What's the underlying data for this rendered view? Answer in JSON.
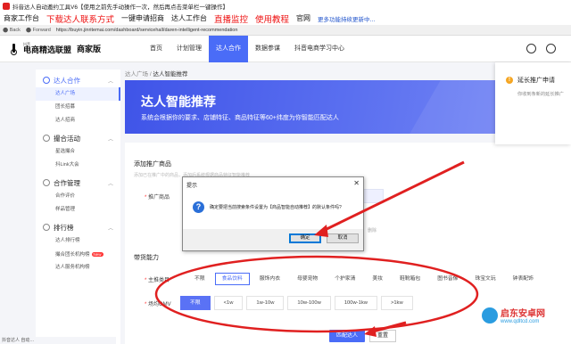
{
  "window": {
    "title": "抖音达人自动邀约工具V6【使用之前先手动操作一次，然后再点击菜单栏一键操作】"
  },
  "linkbar": {
    "items": [
      {
        "label": "商家工作台",
        "style": "black"
      },
      {
        "label": "下载达人联系方式",
        "style": "red"
      },
      {
        "label": "一键申请招商",
        "style": "black"
      },
      {
        "label": "达人工作台",
        "style": "black"
      },
      {
        "label": "直播监控",
        "style": "red"
      },
      {
        "label": "使用教程",
        "style": "red"
      },
      {
        "label": "官网",
        "style": "black"
      },
      {
        "label": "更多功能持续更新中...",
        "style": "blue"
      }
    ]
  },
  "addressbar": {
    "back": "Back",
    "forward": "Forward",
    "url": "https://buyin.jinritemai.com/dashboard/servicehall/daren-intelligent-recommendation"
  },
  "header": {
    "logo_top": "抖音",
    "logo_main": "电商精选联盟",
    "merchant": "商家版",
    "nav": [
      "首页",
      "计划管理",
      "达人合作",
      "数据参谋",
      "抖音电商学习中心"
    ],
    "active_nav": 2
  },
  "sidebar": {
    "groups": [
      {
        "label": "达人合作",
        "highlight": true,
        "items": [
          {
            "label": "达人广场",
            "active": true
          },
          {
            "label": "团长招募"
          },
          {
            "label": "达人招商"
          }
        ]
      },
      {
        "label": "撮合活动",
        "items": [
          {
            "label": "星选撮合"
          },
          {
            "label": "抖Link大会"
          }
        ]
      },
      {
        "label": "合作管理",
        "items": [
          {
            "label": "合作评价"
          },
          {
            "label": "样品管理"
          }
        ]
      },
      {
        "label": "排行榜",
        "items": [
          {
            "label": "达人排行榜"
          },
          {
            "label": "撮合团长机构榜",
            "badge": "New"
          },
          {
            "label": "达人服务机构榜"
          }
        ]
      }
    ]
  },
  "breadcrumb": {
    "parent": "达人广场",
    "sep": "/",
    "current": "达人智能推荐"
  },
  "banner": {
    "title": "达人智能推荐",
    "subtitle": "系统会根据你的要求、店铺特征、商品特征等60+纬度为你智能匹配达人"
  },
  "form": {
    "section1": "添加推广商品",
    "section1_hint": "添加已在推广中的商品，添加后系统根据商品特征智能推荐",
    "product_label": "推广商品",
    "delete_label": "删除",
    "section2": "带货能力",
    "category_label": "主推类目",
    "categories": [
      "不限",
      "食品饮料",
      "服饰内衣",
      "母婴宠物",
      "个护家清",
      "美妆",
      "鞋靴箱包",
      "图书音像",
      "珠宝文玩",
      "钟表配饰"
    ],
    "selected_category": 1,
    "gmv_label": "场均GMV",
    "gmv_options": [
      "不限",
      "<1w",
      "1w-10w",
      "10w-100w",
      "100w-1kw",
      ">1kw"
    ],
    "selected_gmv": 0,
    "match_button": "匹配达人",
    "reset_button": "重置"
  },
  "notification": {
    "title": "延长推广申请",
    "desc": "你收到条新的延长推广"
  },
  "dialog": {
    "title": "提示",
    "message": "确定要把当前搜索条件设置为【商品智能自动推荐】的默认条件吗?",
    "ok": "确定",
    "cancel": "取消"
  },
  "watermark": {
    "name": "启东安卓网",
    "url": "www.qdltcd.com"
  },
  "bottom_fragment": "抖音达人  自动…",
  "colors": {
    "accent": "#4a6cf7",
    "annotation_red": "#e02020"
  }
}
